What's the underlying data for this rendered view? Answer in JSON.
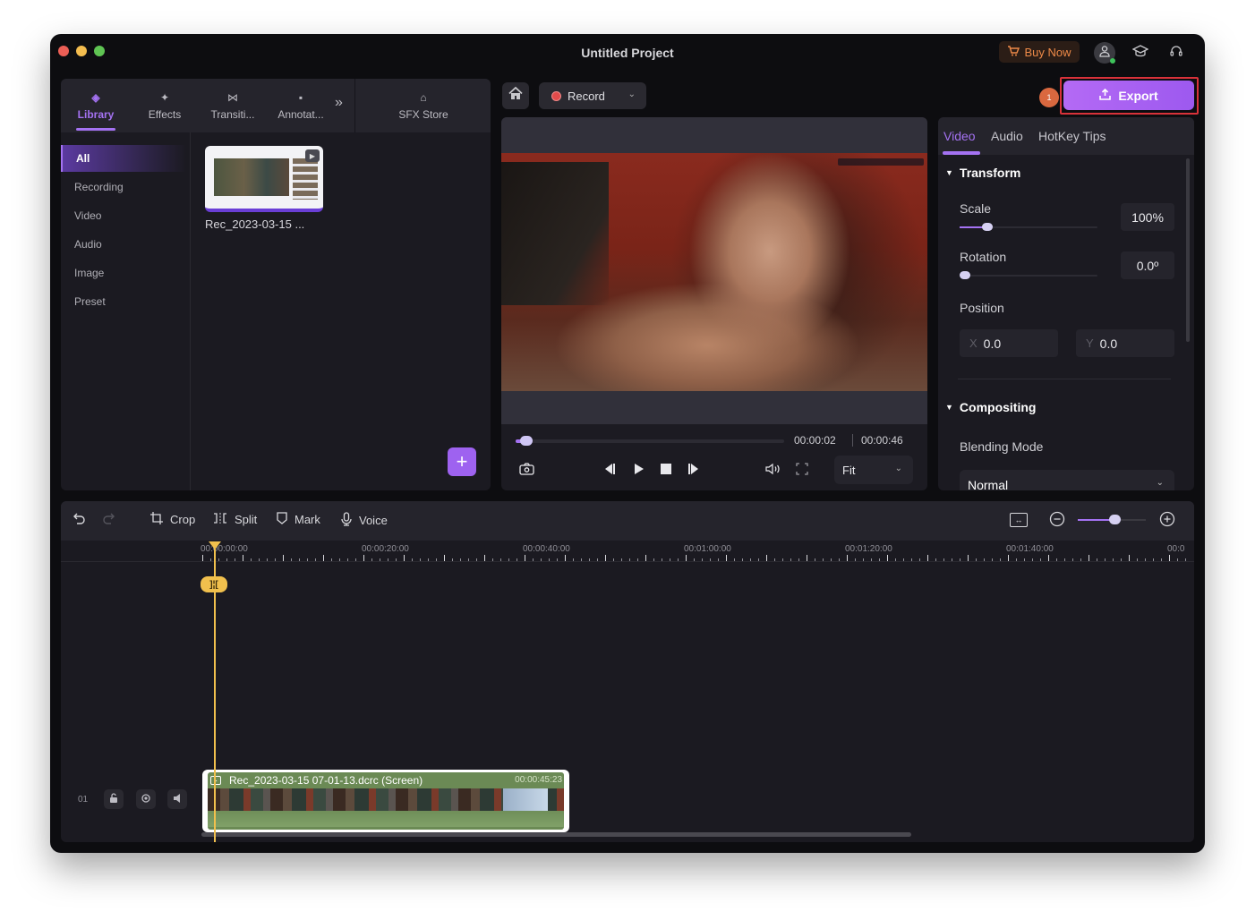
{
  "window": {
    "title": "Untitled Project",
    "buy_now_label": "Buy Now"
  },
  "header_icons": [
    "account-icon",
    "graduation-cap-icon",
    "headset-icon"
  ],
  "library_panel": {
    "tabs": [
      {
        "label": "Library",
        "icon": "layers-icon",
        "active": true
      },
      {
        "label": "Effects",
        "icon": "sparkle-icon",
        "active": false
      },
      {
        "label": "Transiti...",
        "icon": "transition-icon",
        "active": false
      },
      {
        "label": "Annotat...",
        "icon": "annotation-icon",
        "active": false
      }
    ],
    "more_label": "»",
    "sfx_store_label": "SFX Store",
    "categories": [
      {
        "label": "All",
        "active": true
      },
      {
        "label": "Recording",
        "active": false
      },
      {
        "label": "Video",
        "active": false
      },
      {
        "label": "Audio",
        "active": false
      },
      {
        "label": "Image",
        "active": false
      },
      {
        "label": "Preset",
        "active": false
      }
    ],
    "media": [
      {
        "name": "Rec_2023-03-15 ...",
        "type": "recording"
      }
    ],
    "add_label": "+"
  },
  "preview": {
    "record_label": "Record",
    "current_time": "00:00:02",
    "total_time": "00:00:46",
    "progress_fraction": 0.04,
    "fit_option": "Fit"
  },
  "export": {
    "label": "Export",
    "step_badge": "1"
  },
  "properties": {
    "tabs": [
      {
        "label": "Video",
        "active": true
      },
      {
        "label": "Audio",
        "active": false
      },
      {
        "label": "HotKey Tips",
        "active": false
      }
    ],
    "transform": {
      "title": "Transform",
      "scale_label": "Scale",
      "scale_value": "100%",
      "scale_fraction": 0.2,
      "rotation_label": "Rotation",
      "rotation_value": "0.0º",
      "rotation_fraction": 0.0,
      "position_label": "Position",
      "x_label": "X",
      "x_value": "0.0",
      "y_label": "Y",
      "y_value": "0.0"
    },
    "compositing": {
      "title": "Compositing",
      "blending_label": "Blending Mode",
      "blending_value": "Normal"
    }
  },
  "timeline": {
    "toolbar": {
      "crop_label": "Crop",
      "split_label": "Split",
      "mark_label": "Mark",
      "voice_label": "Voice",
      "zoom_fraction": 0.55
    },
    "ruler_labels": [
      "00:00:00:00",
      "00:00:20:00",
      "00:00:40:00",
      "00:01:00:00",
      "00:01:20:00",
      "00:01:40:00",
      "00:0"
    ],
    "track_number": "01",
    "clip": {
      "title": "Rec_2023-03-15 07-01-13.dcrc (Screen)",
      "duration": "00:00:45:23"
    }
  }
}
